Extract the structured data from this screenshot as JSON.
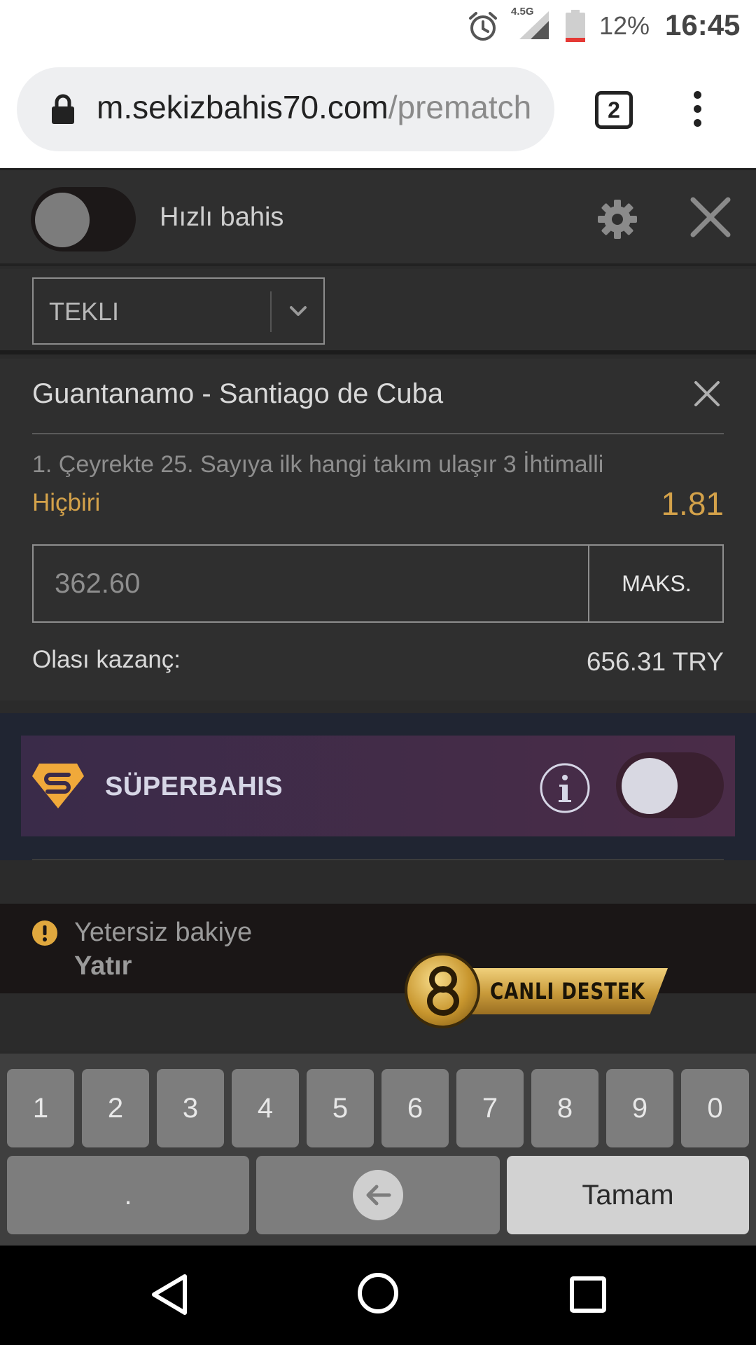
{
  "status_bar": {
    "network": "4.5G",
    "battery": "12%",
    "time": "16:45"
  },
  "browser": {
    "url_host": "m.sekizbahis70.com",
    "url_path": "/prematch",
    "tab_count": "2"
  },
  "header": {
    "quick_bet_label": "Hızlı bahis",
    "quick_bet_enabled": false
  },
  "bet_type": {
    "selected": "TEKLI"
  },
  "bet": {
    "match": "Guantanamo - Santiago de Cuba",
    "market": "1. Çeyrekte 25. Sayıya ilk hangi takım ulaşır 3 İhtimalli",
    "selection": "Hiçbiri",
    "odds": "1.81",
    "stake_placeholder": "362.60",
    "max_label": "MAKS.",
    "potential_win_label": "Olası kazanç:",
    "potential_win_value": "656.31 TRY"
  },
  "superbahis": {
    "label": "SÜPERBAHIS",
    "enabled": false
  },
  "alert": {
    "title": "Yetersiz bakiye",
    "link": "Yatır"
  },
  "live_support": {
    "label": "CANLI DESTEK"
  },
  "keyboard": {
    "digits": [
      "1",
      "2",
      "3",
      "4",
      "5",
      "6",
      "7",
      "8",
      "9",
      "0"
    ],
    "dot": ".",
    "done": "Tamam"
  },
  "colors": {
    "accent_gold": "#d4a24a",
    "panel": "#2f2f2f",
    "superbahis_bg": "#4a2c48"
  },
  "icons": [
    "alarm-icon",
    "signal-icon",
    "battery-icon",
    "lock-icon",
    "gear-icon",
    "close-icon",
    "chevron-down-icon",
    "info-icon",
    "warning-icon",
    "backspace-icon",
    "nav-back-icon",
    "nav-home-icon",
    "nav-recents-icon"
  ]
}
